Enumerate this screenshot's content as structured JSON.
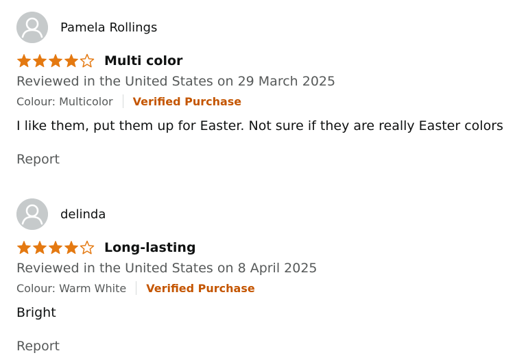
{
  "colors": {
    "star": "#e47911",
    "verified": "#c45500",
    "muted_text": "#565959",
    "avatar_bg": "#c6cacb"
  },
  "reviews": [
    {
      "profile_name": "Pamela Rollings",
      "rating": 4,
      "max_rating": 5,
      "title": "Multi color",
      "date_text": "Reviewed in the United States on 29 March 2025",
      "variant": "Colour: Multicolor",
      "verified_label": "Verified Purchase",
      "body": "I like them, put them up for Easter. Not sure if they are really Easter colors",
      "report_label": "Report",
      "avatar_icon": "default-user-avatar-icon"
    },
    {
      "profile_name": "delinda",
      "rating": 4,
      "max_rating": 5,
      "title": "Long-lasting",
      "date_text": "Reviewed in the United States on 8 April 2025",
      "variant": "Colour: Warm White",
      "verified_label": "Verified Purchase",
      "body": "Bright",
      "report_label": "Report",
      "avatar_icon": "default-user-avatar-icon"
    }
  ]
}
